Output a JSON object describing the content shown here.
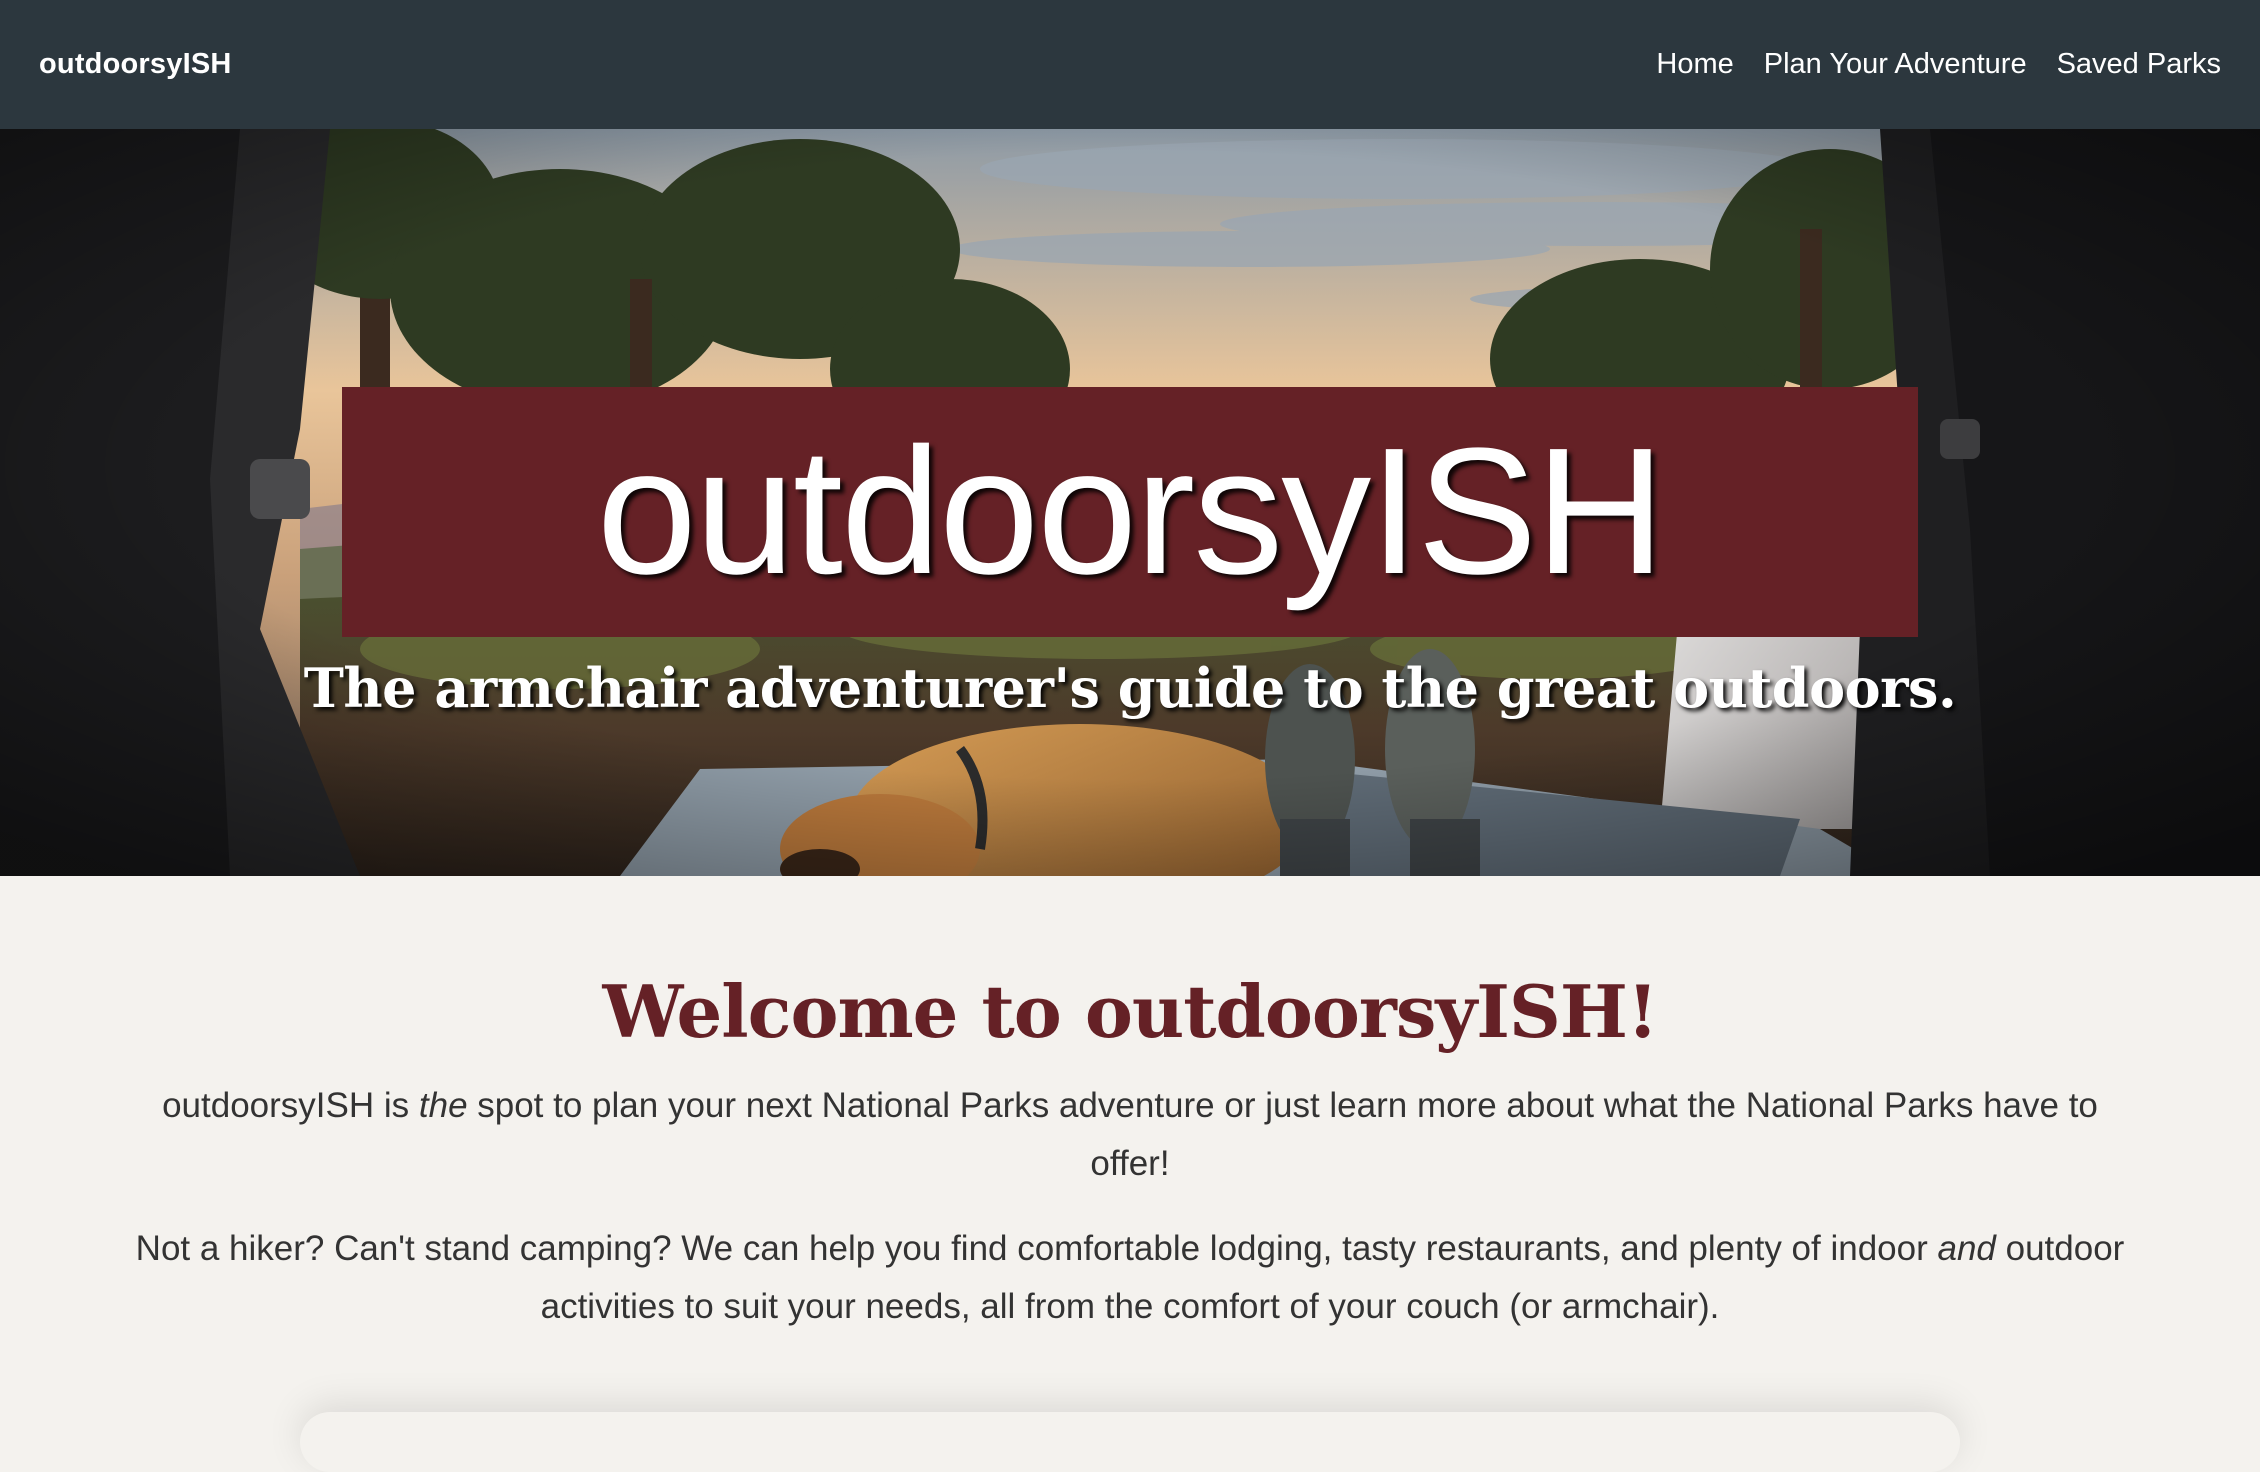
{
  "navbar": {
    "brand": "outdoorsyISH",
    "links": [
      "Home",
      "Plan Your Adventure",
      "Saved Parks"
    ]
  },
  "hero": {
    "title": "outdoorsyISH",
    "tagline": "The armchair adventurer's guide to the great outdoors."
  },
  "welcome": {
    "heading": "Welcome to outdoorsyISH!",
    "p1_before": "outdoorsyISH is ",
    "p1_em": "the",
    "p1_after": " spot to plan your next National Parks adventure or just learn more about what the National Parks have to offer!",
    "p2_before": "Not a hiker? Can't stand camping? We can help you find comfortable lodging, tasty restaurants, and plenty of indoor ",
    "p2_em": "and",
    "p2_after": " outdoor activities to suit your needs, all from the comfort of your couch (or armchair)."
  },
  "colors": {
    "navbar_bg": "#2c373e",
    "accent": "#652126",
    "page_bg": "#f4f2ee",
    "body_text": "#333333"
  }
}
